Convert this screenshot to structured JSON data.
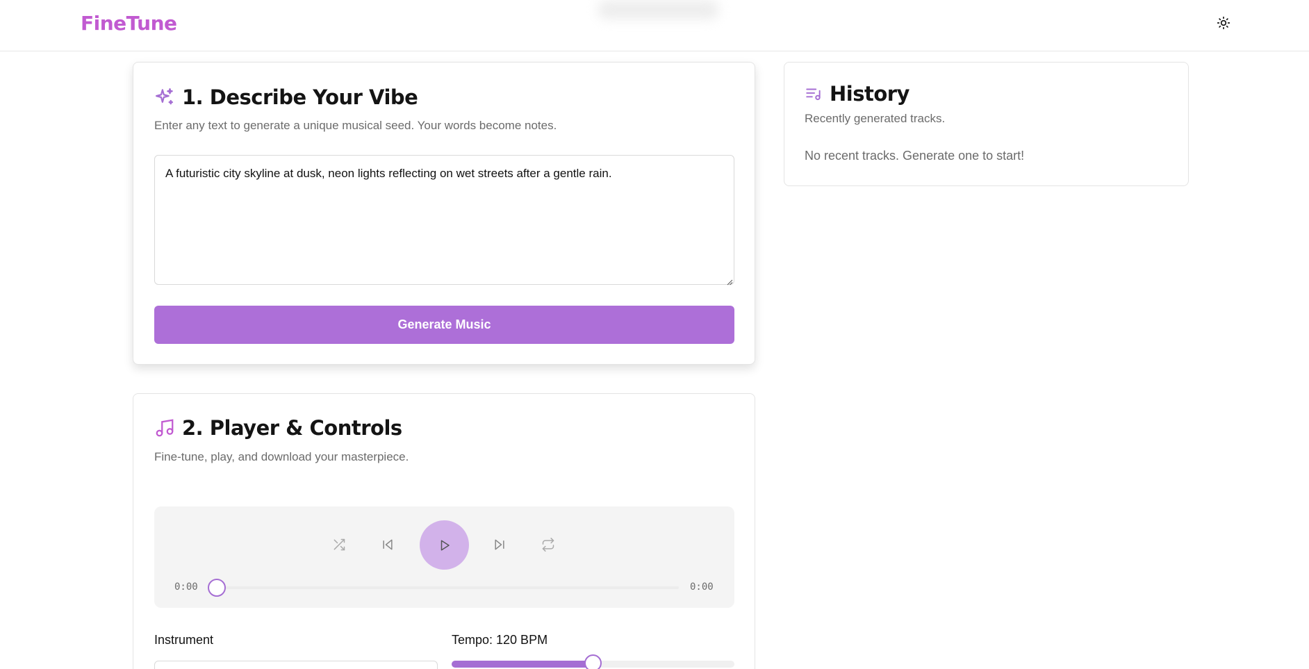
{
  "app": {
    "logo": "FineTune",
    "brand_color": "#c15ad1",
    "accent_color": "#ad6fd8",
    "theme_toggle_icon": "sun-icon"
  },
  "describe": {
    "title": "1. Describe Your Vibe",
    "title_icon": "sparkles-icon",
    "subtitle": "Enter any text to generate a unique musical seed. Your words become notes.",
    "input_value": "A futuristic city skyline at dusk, neon lights reflecting on wet streets after a gentle rain.",
    "generate_label": "Generate Music"
  },
  "history": {
    "title": "History",
    "title_icon": "music-list-icon",
    "subtitle": "Recently generated tracks.",
    "empty_text": "No recent tracks. Generate one to start!"
  },
  "player": {
    "title": "2. Player & Controls",
    "title_icon": "music-note-icon",
    "subtitle": "Fine-tune, play, and download your masterpiece.",
    "controls": [
      "shuffle-icon",
      "previous-icon",
      "play-icon",
      "next-icon",
      "repeat-icon"
    ],
    "current_time": "0:00",
    "total_time": "0:00",
    "progress": 0,
    "instrument_label": "Instrument",
    "tempo_label": "Tempo: 120 BPM",
    "tempo_value": 120,
    "tempo_fraction": 0.5
  }
}
